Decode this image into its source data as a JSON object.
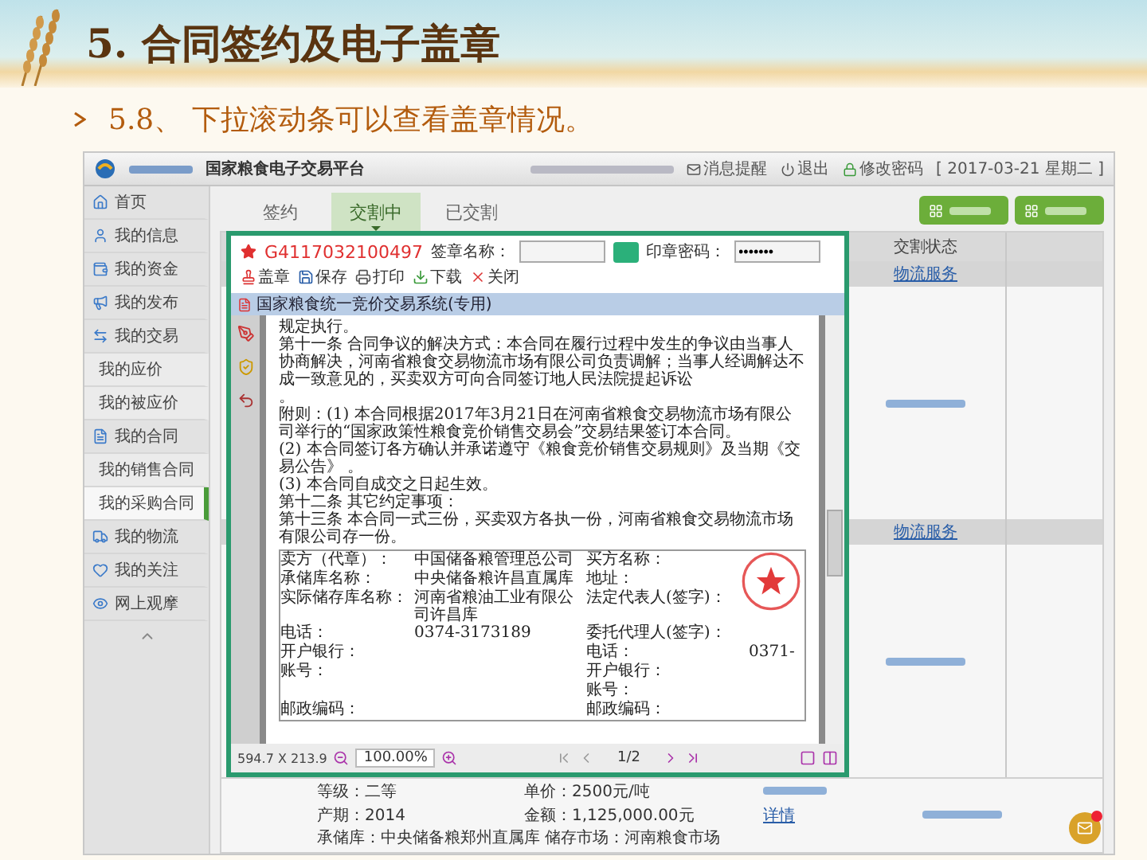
{
  "slide": {
    "title": "5. 合同签约及电子盖章",
    "subtitle": "5.8、 下拉滚动条可以查看盖章情况。"
  },
  "app": {
    "platform_name": "国家粮食电子交易平台",
    "top_links": [
      {
        "kind": "message",
        "label": "消息提醒"
      },
      {
        "kind": "logout",
        "label": "退出"
      },
      {
        "kind": "password",
        "label": "修改密码"
      }
    ],
    "date": "[ 2017-03-21 星期二 ]",
    "sidebar": [
      {
        "label": "首页",
        "selected": false
      },
      {
        "label": "我的信息",
        "selected": false
      },
      {
        "label": "我的资金",
        "selected": false
      },
      {
        "label": "我的发布",
        "selected": false
      },
      {
        "label": "我的交易",
        "selected": false,
        "children": [
          {
            "label": "我的应价",
            "selected": false
          },
          {
            "label": "我的被应价",
            "selected": false
          }
        ]
      },
      {
        "label": "我的合同",
        "selected": false,
        "children": [
          {
            "label": "我的销售合同",
            "selected": false
          },
          {
            "label": "我的采购合同",
            "selected": true
          }
        ]
      },
      {
        "label": "我的物流",
        "selected": false
      },
      {
        "label": "我的关注",
        "selected": false
      },
      {
        "label": "网上观摩",
        "selected": false
      }
    ],
    "tabs": [
      {
        "label": "签约",
        "selected": false
      },
      {
        "label": "交割中",
        "selected": true
      },
      {
        "label": "已交割",
        "selected": false
      }
    ],
    "table": {
      "status_header": "交割状态",
      "status_links": [
        "物流服务",
        "物流服务"
      ],
      "grade": "等级：二等",
      "price": "单价：2500元/吨",
      "year": "产期：2014",
      "amount": "金额：1,125,000.00元",
      "detail_link": "详情",
      "storage": "承储库：中央储备粮郑州直属库   储存市场：河南粮食市场"
    }
  },
  "viewer": {
    "contract_no": "G4117032100497",
    "seal_name_label": "签章名称：",
    "seal_password_label": "印章密码：",
    "password": "•••••••",
    "actions": [
      {
        "kind": "stamp",
        "label": "盖章"
      },
      {
        "kind": "save",
        "label": "保存"
      },
      {
        "kind": "print",
        "label": "打印"
      },
      {
        "kind": "download",
        "label": "下载"
      },
      {
        "kind": "close",
        "label": "关闭"
      }
    ],
    "document_title": "国家粮食统一竞价交易系统(专用)",
    "paragraphs": [
      "规定执行。",
      "第十一条 合同争议的解决方式：本合同在履行过程中发生的争议由当事人协商解决，河南省粮食交易物流市场有限公司负责调解；当事人经调解达不成一致意见的，买卖双方可向合同签订地人民法院提起诉讼",
      "。",
      "附则：(1) 本合同根据2017年3月21日在河南省粮食交易物流市场有限公司举行的“国家政策性粮食竞价销售交易会”交易结果签订本合同。",
      "(2) 本合同签订各方确认并承诺遵守《粮食竞价销售交易规则》及当期《交易公告》 。",
      "(3) 本合同自成交之日起生效。",
      "第十二条 其它约定事项：",
      "第十三条 本合同一式三份，买卖双方各执一份，河南省粮食交易物流市场有限公司存一份。"
    ],
    "parties": [
      {
        "left_label": "卖方（代章）：",
        "left_value": "中国储备粮管理总公司",
        "right_label": "买方名称："
      },
      {
        "left_label": "承储库名称：",
        "left_value": "中央储备粮许昌直属库",
        "right_label": "地址："
      },
      {
        "left_label": "实际储存库名称：",
        "left_value": "河南省粮油工业有限公司许昌库",
        "right_label": "法定代表人(签字)："
      },
      {
        "left_label": "电话：",
        "left_value": "0374-3173189",
        "right_label": "委托代理人(签字)："
      },
      {
        "left_label": "开户银行：",
        "right_label": "电话：",
        "right_value": "0371-"
      },
      {
        "left_label": "账号：",
        "right_label": "开户银行："
      },
      {
        "right_label": "账号："
      },
      {
        "left_label": "邮政编码：",
        "right_label": "邮政编码："
      }
    ],
    "page_size": "594.7 X 213.9",
    "zoom": "100.00%",
    "page": "1/2"
  }
}
